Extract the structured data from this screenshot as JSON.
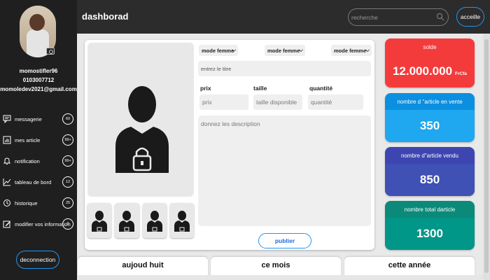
{
  "header": {
    "title": "dashborad",
    "search_placeholder": "recherche",
    "home_label": "acceille"
  },
  "profile": {
    "username": "momostifler96",
    "phone": "0103007712",
    "email": "momoledev2021@gmail.com"
  },
  "sidebar": {
    "items": [
      {
        "label": "messagerie",
        "badge": "60",
        "icon": "message-icon"
      },
      {
        "label": "mes article",
        "badge": "99+",
        "icon": "article-icon"
      },
      {
        "label": "notification",
        "badge": "99+",
        "icon": "bell-icon"
      },
      {
        "label": "tableau de bord",
        "badge": "12",
        "icon": "chart-icon"
      },
      {
        "label": "historique",
        "badge": "25",
        "icon": "history-icon"
      },
      {
        "label": "modifier vos information",
        "badge": "0",
        "icon": "edit-icon"
      }
    ],
    "logout_label": "deconnection"
  },
  "form": {
    "selects": [
      "mode femme",
      "mode femme",
      "mode femme"
    ],
    "title_placeholder": "entrez le titre",
    "price_label": "prix",
    "price_placeholder": "prix",
    "size_label": "taille",
    "size_placeholder": "taille disponible",
    "qty_label": "quantité",
    "qty_placeholder": "quantité",
    "description_placeholder": "donnez les description",
    "publish_label": "publier"
  },
  "stats": [
    {
      "label": "solde",
      "value": "12.000.000",
      "unit": "FrCfa",
      "head_color": "#f43b3b",
      "body_color": "#f43b3b"
    },
    {
      "label": "nombre d ''article en vente",
      "value": "350",
      "unit": "",
      "head_color": "#0b8fe0",
      "body_color": "#1fa7f0"
    },
    {
      "label": "nombre d\"article vendu",
      "value": "850",
      "unit": "",
      "head_color": "#3d46b0",
      "body_color": "#3f51b5"
    },
    {
      "label": "nombre total darticle",
      "value": "1300",
      "unit": "",
      "head_color": "#0b8a7a",
      "body_color": "#009688"
    }
  ],
  "periods": [
    "aujoud huit",
    "ce mois",
    "cette année"
  ]
}
